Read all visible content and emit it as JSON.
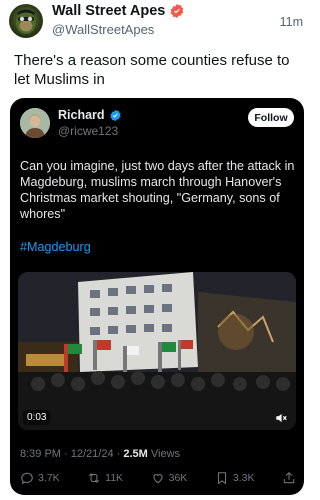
{
  "author": {
    "name": "Wall Street Apes",
    "handle": "@WallStreetApes",
    "time": "11m",
    "avatar_icon": "ape-avatar-icon"
  },
  "tweet": {
    "text": "There's a reason some counties refuse to let Muslims in"
  },
  "quoted": {
    "name": "Richard",
    "handle": "@ricwe123",
    "follow_label": "Follow",
    "text": "Can you imagine, just two days after the attack in Magdeburg, muslims march through Hanover's Christmas market shouting, \"Germany, sons of whores\"",
    "hashtag": "#Magdeburg",
    "video": {
      "duration": "0:03"
    },
    "meta": {
      "time": "8:39 PM · 12/21/24 · ",
      "views": "2.5M",
      "views_label": " Views"
    },
    "actions": {
      "replies": "3.7K",
      "reposts": "11K",
      "likes": "36K",
      "bookmarks": "3.3K"
    }
  },
  "colors": {
    "verified": "#1d9bf0",
    "link": "#1d9bf0",
    "muted": "#71767b"
  }
}
